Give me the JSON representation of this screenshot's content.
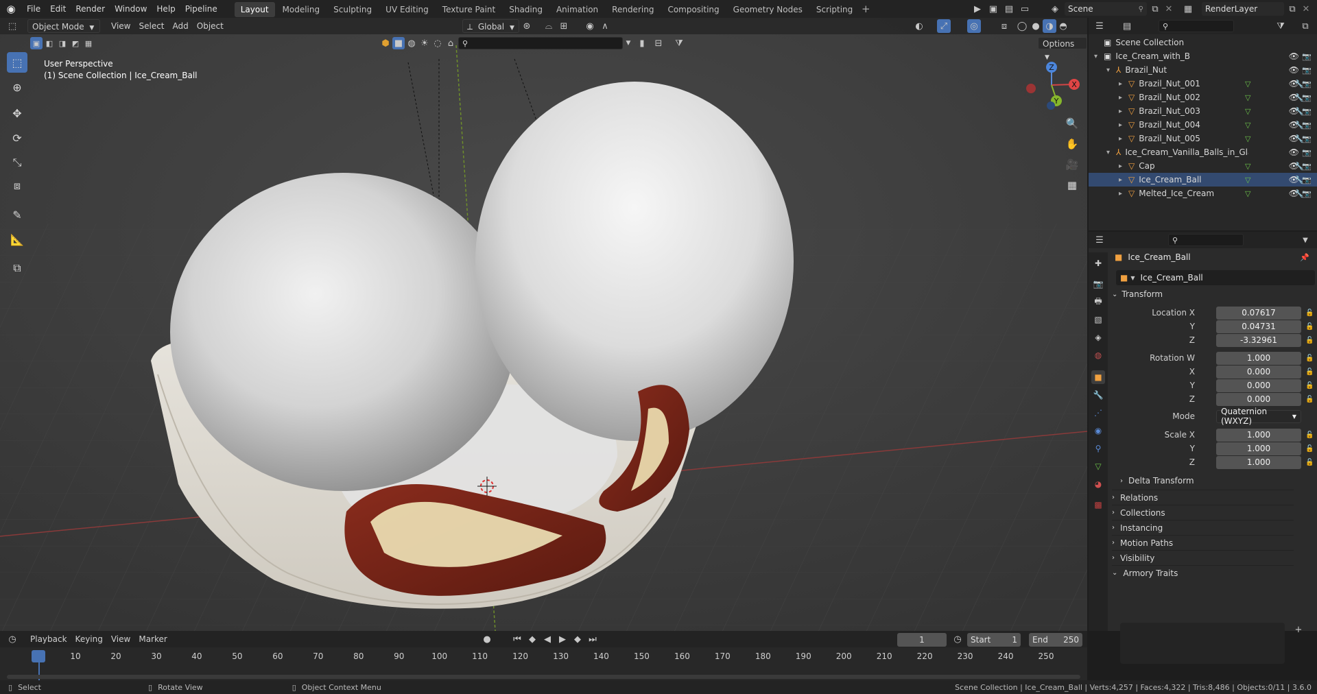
{
  "app": {
    "menus": [
      "File",
      "Edit",
      "Render",
      "Window",
      "Help",
      "Pipeline"
    ],
    "workspaces": [
      "Layout",
      "Modeling",
      "Sculpting",
      "UV Editing",
      "Texture Paint",
      "Shading",
      "Animation",
      "Rendering",
      "Compositing",
      "Geometry Nodes",
      "Scripting"
    ],
    "active_workspace": "Layout",
    "scene_name": "Scene",
    "view_layer": "RenderLayer"
  },
  "viewport_header": {
    "mode": "Object Mode",
    "menus": [
      "View",
      "Select",
      "Add",
      "Object"
    ],
    "orientation": "Global",
    "options_label": "Options"
  },
  "viewport": {
    "perspective_label": "User Perspective",
    "context_label": "(1) Scene Collection | Ice_Cream_Ball",
    "gizmo_axes": {
      "x": "X",
      "y": "Y",
      "z": "Z"
    }
  },
  "outliner": {
    "root": "Scene Collection",
    "rows": [
      {
        "label": "Ice_Cream_with_Brazil_Nuts",
        "level": 0,
        "type": "collection"
      },
      {
        "label": "Brazil_Nut",
        "level": 1,
        "type": "empty"
      },
      {
        "label": "Brazil_Nut_001",
        "level": 2,
        "type": "mesh"
      },
      {
        "label": "Brazil_Nut_002",
        "level": 2,
        "type": "mesh"
      },
      {
        "label": "Brazil_Nut_003",
        "level": 2,
        "type": "mesh"
      },
      {
        "label": "Brazil_Nut_004",
        "level": 2,
        "type": "mesh"
      },
      {
        "label": "Brazil_Nut_005",
        "level": 2,
        "type": "mesh"
      },
      {
        "label": "Ice_Cream_Vanilla_Balls_in_Glass_E",
        "level": 1,
        "type": "empty"
      },
      {
        "label": "Cap",
        "level": 2,
        "type": "mesh"
      },
      {
        "label": "Ice_Cream_Ball",
        "level": 2,
        "type": "mesh"
      },
      {
        "label": "Melted_Ice_Cream",
        "level": 2,
        "type": "mesh"
      }
    ]
  },
  "properties": {
    "object_name": "Ice_Cream_Ball",
    "datablock_name": "Ice_Cream_Ball",
    "transform_title": "Transform",
    "location": {
      "label_x": "Location X",
      "label_y": "Y",
      "label_z": "Z",
      "x": "0.07617",
      "y": "0.04731",
      "z": "-3.32961"
    },
    "rotation": {
      "label_w": "Rotation W",
      "label_x": "X",
      "label_y": "Y",
      "label_z": "Z",
      "w": "1.000",
      "x": "0.000",
      "y": "0.000",
      "z": "0.000"
    },
    "mode_label": "Mode",
    "mode_value": "Quaternion (WXYZ)",
    "scale": {
      "label_x": "Scale X",
      "label_y": "Y",
      "label_z": "Z",
      "x": "1.000",
      "y": "1.000",
      "z": "1.000"
    },
    "delta_transform": "Delta Transform",
    "panels": [
      "Relations",
      "Collections",
      "Instancing",
      "Motion Paths",
      "Visibility",
      "Armory Traits"
    ]
  },
  "timeline": {
    "menus": [
      "Playback",
      "Keying",
      "View",
      "Marker"
    ],
    "current_frame": "1",
    "start_label": "Start",
    "start_value": "1",
    "end_label": "End",
    "end_value": "250",
    "ticks": [
      "1",
      "10",
      "20",
      "30",
      "40",
      "50",
      "60",
      "70",
      "80",
      "90",
      "100",
      "110",
      "120",
      "130",
      "140",
      "150",
      "160",
      "170",
      "180",
      "190",
      "200",
      "210",
      "220",
      "230",
      "240",
      "250"
    ]
  },
  "statusbar": {
    "select": "Select",
    "rotate": "Rotate View",
    "context_menu": "Object Context Menu",
    "stats": "Scene Collection | Ice_Cream_Ball | Verts:4,257 | Faces:4,322 | Tris:8,486 | Objects:0/11 | 3.6.0"
  }
}
